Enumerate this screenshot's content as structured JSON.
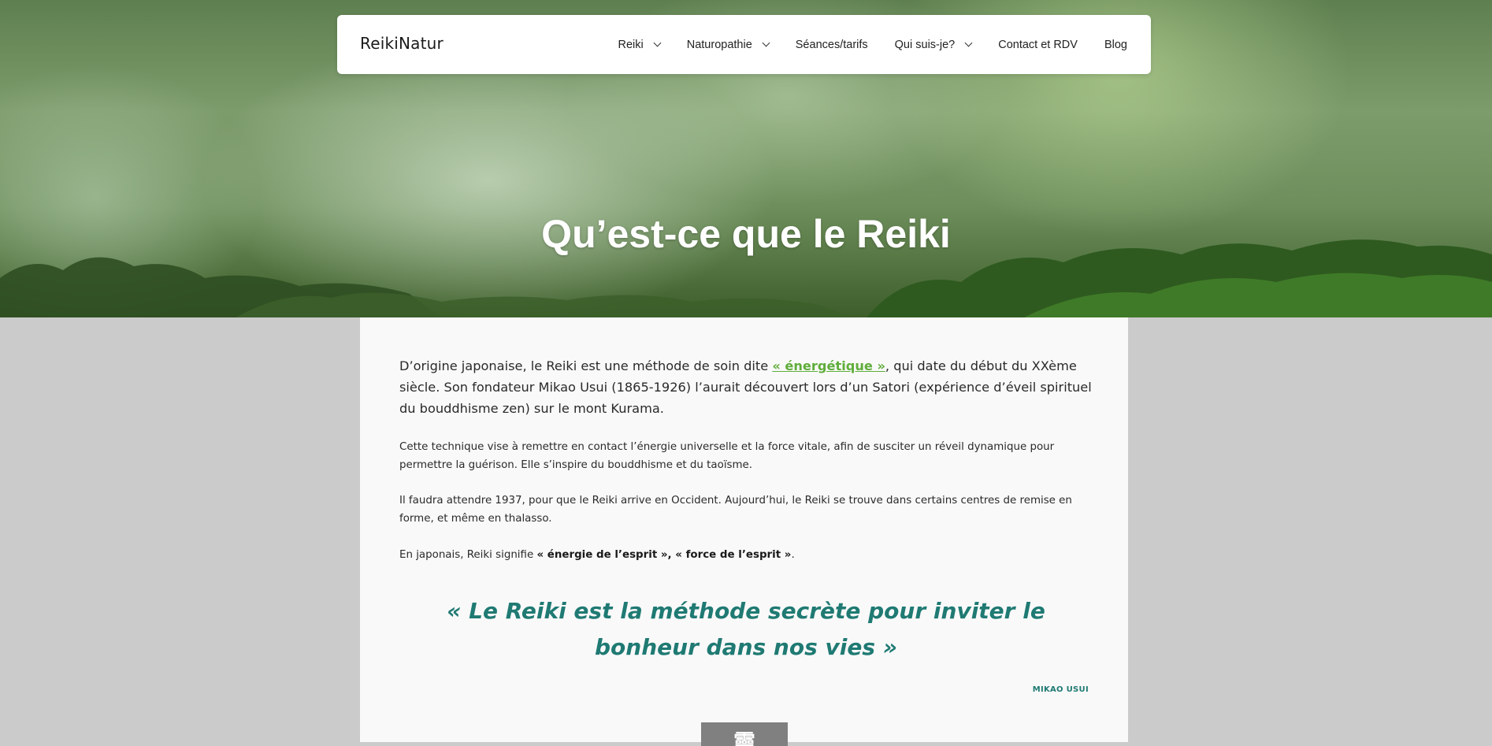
{
  "brand": "ReikiNatur",
  "nav": {
    "items": [
      {
        "label": "Reiki",
        "has_dropdown": true
      },
      {
        "label": "Naturopathie",
        "has_dropdown": true
      },
      {
        "label": "Séances/tarifs",
        "has_dropdown": false
      },
      {
        "label": "Qui suis-je?",
        "has_dropdown": true
      },
      {
        "label": "Contact et RDV",
        "has_dropdown": false
      },
      {
        "label": "Blog",
        "has_dropdown": false
      }
    ]
  },
  "hero": {
    "title": "Qu’est-ce que le Reiki"
  },
  "content": {
    "lead_before": "D’origine japonaise, le Reiki est une méthode de soin dite ",
    "lead_link": "« énergétique »",
    "lead_after": ", qui date du début du XXème siècle. Son fondateur Mikao Usui (1865-1926) l’aurait découvert lors d’un Satori (expérience d’éveil spirituel du bouddhisme zen) sur le mont Kurama.",
    "para2": "Cette technique vise à remettre en contact l’énergie universelle et la force vitale, afin de susciter un réveil dynamique pour permettre la guérison. Elle s’inspire du bouddhisme et du taoïsme.",
    "para3": "Il faudra attendre 1937, pour que le Reiki arrive en Occident. Aujourd’hui, le Reiki se trouve dans certains centres de remise en forme, et même en thalasso.",
    "para4_before": "En japonais, Reiki signifie ",
    "para4_bold": "« énergie de l’esprit », « force de l’esprit »",
    "para4_after": ".",
    "quote": "« Le Reiki est la méthode secrète pour inviter le bonheur dans nos vies »",
    "quote_author": "MIKAO USUI",
    "kanji": "靈"
  },
  "colors": {
    "accent_teal": "#1f7a73",
    "link_green": "#5fad3a",
    "page_bg": "#cbcbcb",
    "content_bg": "#f9f9f9"
  }
}
